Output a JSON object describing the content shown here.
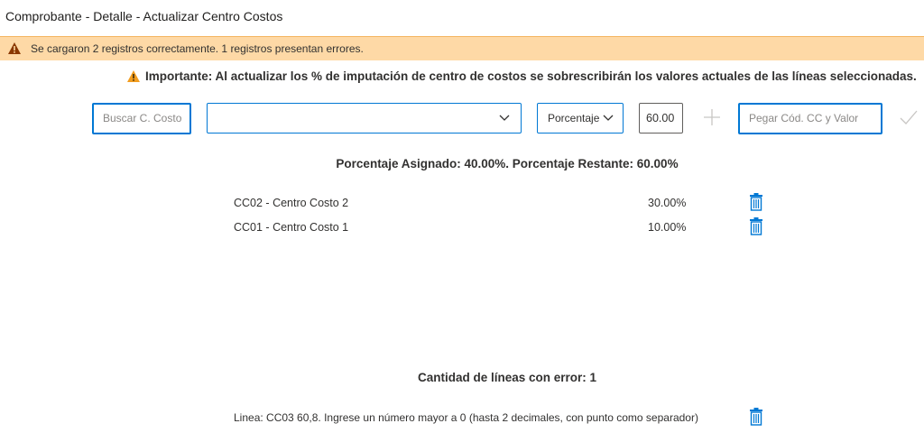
{
  "window": {
    "title": "Comprobante - Detalle - Actualizar Centro Costos"
  },
  "warning_bar": {
    "message": "Se cargaron 2 registros correctamente. 1 registros presentan errores.",
    "icon": "warning-icon",
    "bg_color": "#fed9a6"
  },
  "notice": {
    "icon": "warning-icon",
    "text": "Importante: Al actualizar los % de imputación de centro de costos se sobrescribirán los valores actuales de las líneas seleccionadas."
  },
  "toolbar": {
    "search_placeholder": "Buscar C. Costo",
    "cost_center_value": "",
    "type_value": "Porcentaje",
    "amount_value": "60.00",
    "paste_placeholder": "Pegar Cód. CC y Valor",
    "accent_color": "#0078d4"
  },
  "summary": {
    "text": "Porcentaje Asignado: 40.00%. Porcentaje Restante: 60.00%"
  },
  "assignments": [
    {
      "name": "CC02 - Centro Costo 2",
      "percent": "30.00%"
    },
    {
      "name": "CC01 - Centro Costo 1",
      "percent": "10.00%"
    }
  ],
  "errors": {
    "title": "Cantidad de líneas con error: 1",
    "lines": [
      {
        "text": "Linea: CC03 60,8. Ingrese un número mayor a 0 (hasta 2 decimales, con punto como separador)"
      }
    ]
  }
}
